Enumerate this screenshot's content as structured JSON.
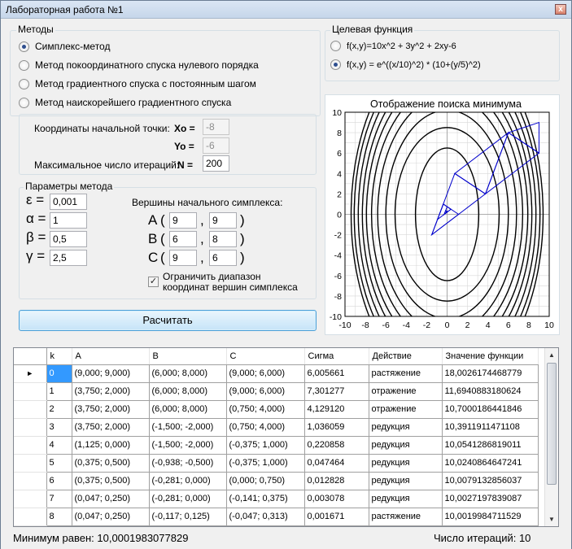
{
  "window": {
    "title": "Лабораторная работа №1",
    "close": "x"
  },
  "methods": {
    "title": "Методы",
    "items": [
      {
        "label": "Симплекс-метод",
        "selected": true
      },
      {
        "label": "Метод покоординатного спуска нулевого порядка",
        "selected": false
      },
      {
        "label": "Метод градиентного спуска с постоянным шагом",
        "selected": false
      },
      {
        "label": "Метод наискорейшего градиентного спуска",
        "selected": false
      }
    ]
  },
  "start": {
    "caption": "Координаты начальной точки:",
    "x0_label": "Xo =",
    "x0": "-8",
    "y0_label": "Yo =",
    "y0": "-6",
    "maxiter_caption": "Максимальное число итераций:",
    "n_label": "N =",
    "n": "200"
  },
  "params": {
    "title": "Параметры метода",
    "eps_label": "ε =",
    "eps": "0,001",
    "alpha_label": "α =",
    "alpha": "1",
    "beta_label": "β =",
    "beta": "0,5",
    "gamma_label": "γ =",
    "gamma": "2,5",
    "vertices_caption": "Вершины начального симплекса:",
    "vertices": [
      {
        "name": "A",
        "x": "9",
        "y": "9"
      },
      {
        "name": "B",
        "x": "6",
        "y": "8"
      },
      {
        "name": "C",
        "x": "9",
        "y": "6"
      }
    ],
    "open": "(",
    "comma": ",",
    "close": ")",
    "limit_line1": "Ограничить диапазон",
    "limit_line2": "координат вершин симплекса",
    "limit_checked": "✓"
  },
  "calculate_button": "Расчитать",
  "target": {
    "title": "Целевая функция",
    "items": [
      {
        "label": "f(x,y)=10x^2 + 3y^2 + 2xy-6",
        "selected": false
      },
      {
        "label": "f(x,y) = e^((x/10)^2) * (10+(y/5)^2)",
        "selected": true
      }
    ]
  },
  "chart_data": {
    "type": "line",
    "title": "Отображение поиска минимума",
    "xlim": [
      -10,
      10
    ],
    "ylim": [
      -10,
      10
    ],
    "x_ticks": [
      -10,
      -8,
      -6,
      -4,
      -2,
      0,
      2,
      4,
      6,
      8,
      10
    ],
    "y_ticks": [
      -10,
      -8,
      -6,
      -4,
      -2,
      0,
      2,
      4,
      6,
      8,
      10
    ],
    "grid": true,
    "contour_levels": [
      {
        "a": 3.1,
        "b": 6.5
      },
      {
        "a": 5.1,
        "b": 8.5
      },
      {
        "a": 6.0,
        "b": 10.2
      },
      {
        "a": 6.8,
        "b": 11.6
      },
      {
        "a": 7.4,
        "b": 12.7
      },
      {
        "a": 7.9,
        "b": 13.7
      },
      {
        "a": 8.3,
        "b": 14.6
      },
      {
        "a": 8.7,
        "b": 15.5
      },
      {
        "a": 9.1,
        "b": 16.3
      },
      {
        "a": 9.4,
        "b": 17.1
      }
    ],
    "simplex_path": [
      {
        "A": [
          9,
          9
        ],
        "B": [
          6,
          8
        ],
        "C": [
          9,
          6
        ]
      },
      {
        "A": [
          3.75,
          2
        ],
        "B": [
          6,
          8
        ],
        "C": [
          9,
          6
        ]
      },
      {
        "A": [
          3.75,
          2
        ],
        "B": [
          6,
          8
        ],
        "C": [
          0.75,
          4
        ]
      },
      {
        "A": [
          3.75,
          2
        ],
        "B": [
          -1.5,
          -2
        ],
        "C": [
          0.75,
          4
        ]
      },
      {
        "A": [
          1.125,
          0
        ],
        "B": [
          -1.5,
          -2
        ],
        "C": [
          -0.375,
          1
        ]
      },
      {
        "A": [
          0.375,
          0.5
        ],
        "B": [
          -0.938,
          -0.5
        ],
        "C": [
          -0.375,
          1
        ]
      },
      {
        "A": [
          0.375,
          0.5
        ],
        "B": [
          -0.281,
          0
        ],
        "C": [
          0,
          0.75
        ]
      },
      {
        "A": [
          0.047,
          0.25
        ],
        "B": [
          -0.281,
          0
        ],
        "C": [
          -0.141,
          0.375
        ]
      },
      {
        "A": [
          0.047,
          0.25
        ],
        "B": [
          -0.117,
          0.125
        ],
        "C": [
          -0.047,
          0.313
        ]
      }
    ],
    "line_color": "#0000cc",
    "contour_color": "#000000"
  },
  "table": {
    "columns": [
      "k",
      "A",
      "B",
      "C",
      "Сигма",
      "Действие",
      "Значение функции"
    ],
    "current_row_marker": "►",
    "rows": [
      [
        "0",
        "(9,000; 9,000)",
        "(6,000; 8,000)",
        "(9,000; 6,000)",
        "6,005661",
        "растяжение",
        "18,0026174468779"
      ],
      [
        "1",
        "(3,750; 2,000)",
        "(6,000; 8,000)",
        "(9,000; 6,000)",
        "7,301277",
        "отражение",
        "11,6940883180624"
      ],
      [
        "2",
        "(3,750; 2,000)",
        "(6,000; 8,000)",
        "(0,750; 4,000)",
        "4,129120",
        "отражение",
        "10,7000186441846"
      ],
      [
        "3",
        "(3,750; 2,000)",
        "(-1,500; -2,000)",
        "(0,750; 4,000)",
        "1,036059",
        "редукция",
        "10,3911911471108"
      ],
      [
        "4",
        "(1,125; 0,000)",
        "(-1,500; -2,000)",
        "(-0,375; 1,000)",
        "0,220858",
        "редукция",
        "10,0541286819011"
      ],
      [
        "5",
        "(0,375; 0,500)",
        "(-0,938; -0,500)",
        "(-0,375; 1,000)",
        "0,047464",
        "редукция",
        "10,0240864647241"
      ],
      [
        "6",
        "(0,375; 0,500)",
        "(-0,281; 0,000)",
        "(0,000; 0,750)",
        "0,012828",
        "редукция",
        "10,0079132856037"
      ],
      [
        "7",
        "(0,047; 0,250)",
        "(-0,281; 0,000)",
        "(-0,141; 0,375)",
        "0,003078",
        "редукция",
        "10,0027197839087"
      ],
      [
        "8",
        "(0,047; 0,250)",
        "(-0,117; 0,125)",
        "(-0,047; 0,313)",
        "0,001671",
        "растяжение",
        "10,0019984711529"
      ]
    ]
  },
  "status": {
    "minimum": "Минимум равен: 10,0001983077829",
    "iterations": "Число итераций: 10"
  },
  "scroll": {
    "up": "▲",
    "down": "▼"
  }
}
